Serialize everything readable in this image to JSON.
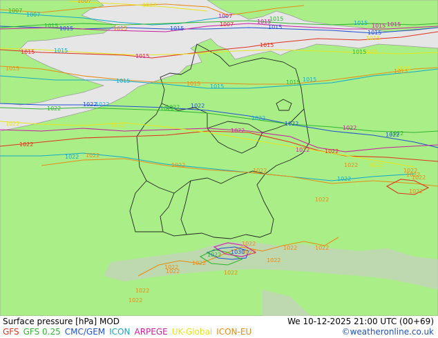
{
  "footer": {
    "title": "Surface pressure [hPa] MOD",
    "datetime": "We 10-12-2025 21:00 UTC (00+69)",
    "credit": "©weatheronline.co.uk",
    "models": [
      {
        "label": "GFS",
        "color": "#e0301e"
      },
      {
        "label": "GFS 0.25",
        "color": "#2fb52f"
      },
      {
        "label": "CMC/GEM",
        "color": "#2050d0"
      },
      {
        "label": "ICON",
        "color": "#15a8c8"
      },
      {
        "label": "ARPEGE",
        "color": "#c81ea0"
      },
      {
        "label": "UK-Global",
        "color": "#e6e61e"
      },
      {
        "label": "ICON-EU",
        "color": "#e68c14"
      }
    ]
  },
  "map": {
    "land_color": "#aaee88",
    "sea_color": "#e6e6e6",
    "labels": [
      {
        "text": "1007",
        "color": "#e68c14"
      },
      {
        "text": "1007",
        "color": "#15a8c8"
      },
      {
        "text": "1007",
        "color": "#e6e61e"
      },
      {
        "text": "1007",
        "color": "#2fb52f"
      },
      {
        "text": "1007",
        "color": "#c81ea0"
      },
      {
        "text": "1007",
        "color": "#e0301e"
      },
      {
        "text": "1015",
        "color": "#e0301e"
      },
      {
        "text": "1015",
        "color": "#15a8c8"
      },
      {
        "text": "1015",
        "color": "#2050d0"
      },
      {
        "text": "1015",
        "color": "#e68c14"
      },
      {
        "text": "1015",
        "color": "#2050d0"
      },
      {
        "text": "1015",
        "color": "#2fb52f"
      },
      {
        "text": "1015",
        "color": "#2050d0"
      },
      {
        "text": "1015",
        "color": "#c81ea0"
      },
      {
        "text": "1015",
        "color": "#2fb52f"
      },
      {
        "text": "1015",
        "color": "#2050d0"
      },
      {
        "text": "1015",
        "color": "#c81ea0"
      },
      {
        "text": "1015",
        "color": "#e0301e"
      },
      {
        "text": "1015",
        "color": "#e6e61e"
      },
      {
        "text": "1015",
        "color": "#c81ea0"
      },
      {
        "text": "1015",
        "color": "#e68c14"
      },
      {
        "text": "1015",
        "color": "#15a8c8"
      },
      {
        "text": "1015",
        "color": "#e68c14"
      },
      {
        "text": "1015",
        "color": "#15a8c8"
      },
      {
        "text": "1015",
        "color": "#2fb52f"
      },
      {
        "text": "1015",
        "color": "#e6e61e"
      },
      {
        "text": "1015",
        "color": "#e68c14"
      },
      {
        "text": "1015",
        "color": "#15a8c8"
      },
      {
        "text": "1015",
        "color": "#e6e61e"
      },
      {
        "text": "1015",
        "color": "#c81ea0"
      },
      {
        "text": "1015",
        "color": "#15a8c8"
      },
      {
        "text": "1015",
        "color": "#2fb52f"
      },
      {
        "text": "1022",
        "color": "#2fb52f"
      },
      {
        "text": "1022",
        "color": "#2050d0"
      },
      {
        "text": "1022",
        "color": "#15a8c8"
      },
      {
        "text": "1022",
        "color": "#2fb52f"
      },
      {
        "text": "1022",
        "color": "#2050d0"
      },
      {
        "text": "1022",
        "color": "#e6e61e"
      },
      {
        "text": "1022",
        "color": "#e6e61e"
      },
      {
        "text": "1022",
        "color": "#c81ea0"
      },
      {
        "text": "1022",
        "color": "#c81ea0"
      },
      {
        "text": "1022",
        "color": "#15a8c8"
      },
      {
        "text": "1022",
        "color": "#2050d0"
      },
      {
        "text": "1022",
        "color": "#2fb52f"
      },
      {
        "text": "1022",
        "color": "#e0301e"
      },
      {
        "text": "1022",
        "color": "#2fb52f"
      },
      {
        "text": "1022",
        "color": "#2050d0"
      },
      {
        "text": "1022",
        "color": "#c81ea0"
      },
      {
        "text": "1022",
        "color": "#15a8c8"
      },
      {
        "text": "1022",
        "color": "#e68c14"
      },
      {
        "text": "1022",
        "color": "#e68c14"
      },
      {
        "text": "1022",
        "color": "#e68c14"
      },
      {
        "text": "1022",
        "color": "#15a8c8"
      },
      {
        "text": "1022",
        "color": "#e68c14"
      },
      {
        "text": "1022",
        "color": "#e68c14"
      },
      {
        "text": "1022",
        "color": "#e0301e"
      },
      {
        "text": "1022",
        "color": "#e68c14"
      },
      {
        "text": "1022",
        "color": "#e68c14"
      },
      {
        "text": "1022",
        "color": "#e6e61e"
      },
      {
        "text": "1022",
        "color": "#e68c14"
      },
      {
        "text": "1022",
        "color": "#e68c14"
      },
      {
        "text": "1022",
        "color": "#e68c14"
      },
      {
        "text": "1022",
        "color": "#e68c14"
      },
      {
        "text": "1022",
        "color": "#e68c14"
      },
      {
        "text": "1022",
        "color": "#e68c14"
      },
      {
        "text": "1022",
        "color": "#2fb52f"
      },
      {
        "text": "1022",
        "color": "#e68c14"
      },
      {
        "text": "1022",
        "color": "#e68c14"
      },
      {
        "text": "1022",
        "color": "#e68c14"
      },
      {
        "text": "1022",
        "color": "#e68c14"
      },
      {
        "text": "1022",
        "color": "#e68c14"
      },
      {
        "text": "1022",
        "color": "#e68c14"
      },
      {
        "text": "1022",
        "color": "#e68c14"
      },
      {
        "text": "1030",
        "color": "#2050d0"
      }
    ]
  }
}
